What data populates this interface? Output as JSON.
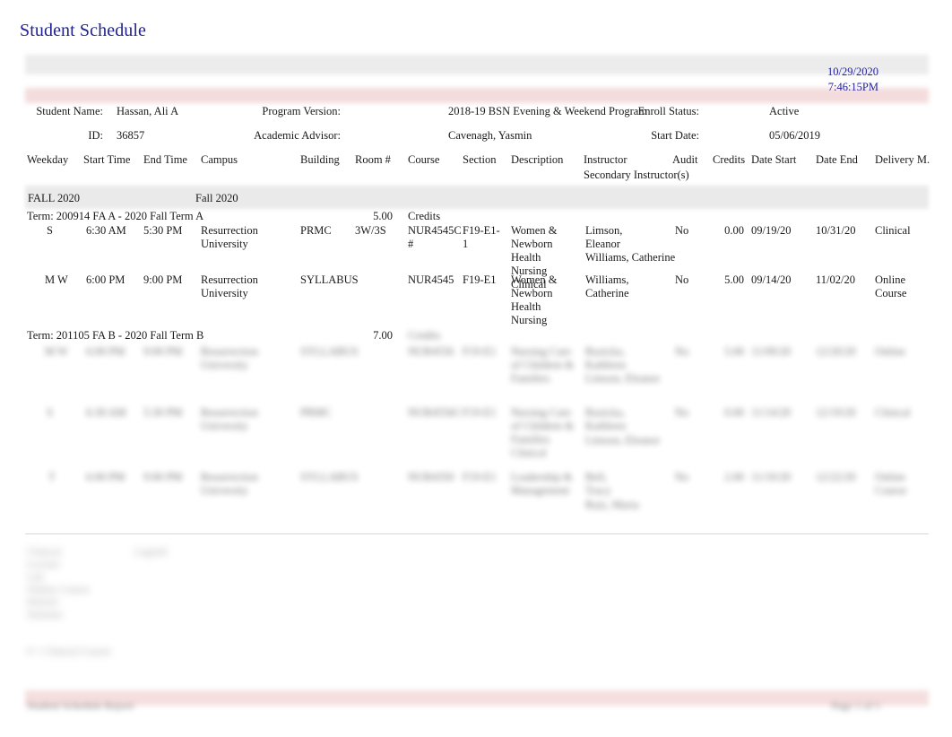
{
  "title": "Student Schedule",
  "colors": {
    "title": "#1f1f8c",
    "timestamp": "#2222a0",
    "band_gray": "#eaeaea",
    "band_pink": "#f4dcdc",
    "footer_pink": "#f5dede",
    "text": "#1a1a1a"
  },
  "timestamp": {
    "date": "10/29/2020",
    "time": "7:46:15PM"
  },
  "meta": {
    "row1": {
      "label_left": "Student Name:",
      "value_left": "Hassan, Ali A",
      "label_mid": "Program Version:",
      "value_mid": "2018-19 BSN Evening & Weekend Program",
      "label_right": "Enroll Status:",
      "value_right": "Active"
    },
    "row2": {
      "label_left": "ID:",
      "value_left": "36857",
      "label_mid": "Academic Advisor:",
      "value_mid": "Cavenagh, Yasmin",
      "label_right": "Start Date:",
      "value_right": "05/06/2019"
    }
  },
  "columns": {
    "weekday": "Weekday",
    "start_time": "Start Time",
    "end_time": "End Time",
    "campus": "Campus",
    "building": "Building",
    "room": "Room #",
    "course": "Course",
    "section": "Section",
    "description": "Description",
    "instructor": "Instructor",
    "secondary_instructor": "Secondary Instructor(s)",
    "audit": "Audit",
    "credits": "Credits",
    "date_start": "Date Start",
    "date_end": "Date End",
    "delivery": "Delivery M."
  },
  "term_band": {
    "left": "FALL 2020",
    "right": "Fall 2020"
  },
  "terms": [
    {
      "label": "Term: 200914 FA A - 2020 Fall Term A",
      "credits_value": "5.00",
      "credits_word": "Credits",
      "redacted": false,
      "rows": [
        {
          "weekday": "S",
          "start_time": "6:30 AM",
          "end_time": "5:30 PM",
          "campus": "Resurrection University",
          "building": "PRMC",
          "room": "3W/3S",
          "course": "NUR4545C #",
          "section": "F19-E1-1",
          "description": "Women & Newborn Health Nursing Clinical",
          "instructor": "Limson, Eleanor",
          "secondary_instructor": "Williams, Catherine",
          "audit": "No",
          "credits": "0.00",
          "date_start": "09/19/20",
          "date_end": "10/31/20",
          "delivery": "Clinical"
        },
        {
          "weekday": "M W",
          "start_time": "6:00 PM",
          "end_time": "9:00 PM",
          "campus": "Resurrection University",
          "building": "SYLLABUS",
          "room": "",
          "course": "NUR4545",
          "section": "F19-E1",
          "description": "Women & Newborn Health Nursing",
          "instructor": "Williams, Catherine",
          "secondary_instructor": "",
          "audit": "No",
          "credits": "5.00",
          "date_start": "09/14/20",
          "date_end": "11/02/20",
          "delivery": "Online Course"
        }
      ]
    },
    {
      "label": "Term: 201105 FA B - 2020 Fall Term B",
      "credits_value": "7.00",
      "credits_word": "Credits",
      "redacted": true,
      "rows": [
        {
          "weekday": "M W",
          "start_time": "6:00 PM",
          "end_time": "9:00 PM",
          "campus": "Resurrection University",
          "building": "SYLLABUS",
          "room": "",
          "course": "NUR4556",
          "section": "F19-E1",
          "description": "Nursing Care of Children & Families",
          "instructor": "Ruzicka, Kathleen",
          "secondary_instructor": "Limson, Eleanor",
          "audit": "No",
          "credits": "5.00",
          "date_start": "11/09/20",
          "date_end": "12/20/20",
          "delivery": "Online"
        },
        {
          "weekday": "S",
          "start_time": "6:30 AM",
          "end_time": "5:30 PM",
          "campus": "Resurrection University",
          "building": "PRMC",
          "room": "",
          "course": "NUR4556C",
          "section": "F19-E1",
          "description": "Nursing Care of Children & Families Clinical",
          "instructor": "Ruzicka, Kathleen",
          "secondary_instructor": "Limson, Eleanor",
          "audit": "No",
          "credits": "0.00",
          "date_start": "11/14/20",
          "date_end": "12/19/20",
          "delivery": "Clinical"
        },
        {
          "weekday": "T",
          "start_time": "6:00 PM",
          "end_time": "9:00 PM",
          "campus": "Resurrection University",
          "building": "SYLLABUS",
          "room": "",
          "course": "NUR4350",
          "section": "F19-E1",
          "description": "Leadership & Management",
          "instructor": "Bell, Tracy",
          "secondary_instructor": "Ruiz, Maria",
          "audit": "No",
          "credits": "2.00",
          "date_start": "11/10/20",
          "date_end": "12/22/20",
          "delivery": "Online Course"
        }
      ]
    }
  ],
  "legend": {
    "heading": "Legend",
    "lines": "Clinical\nLecture\nLab\nOnline Course\nHybrid\nSeminar",
    "note": "# = Clinical Course"
  },
  "footer": {
    "left": "Student Schedule Report",
    "right": "Page 1 of 1"
  }
}
